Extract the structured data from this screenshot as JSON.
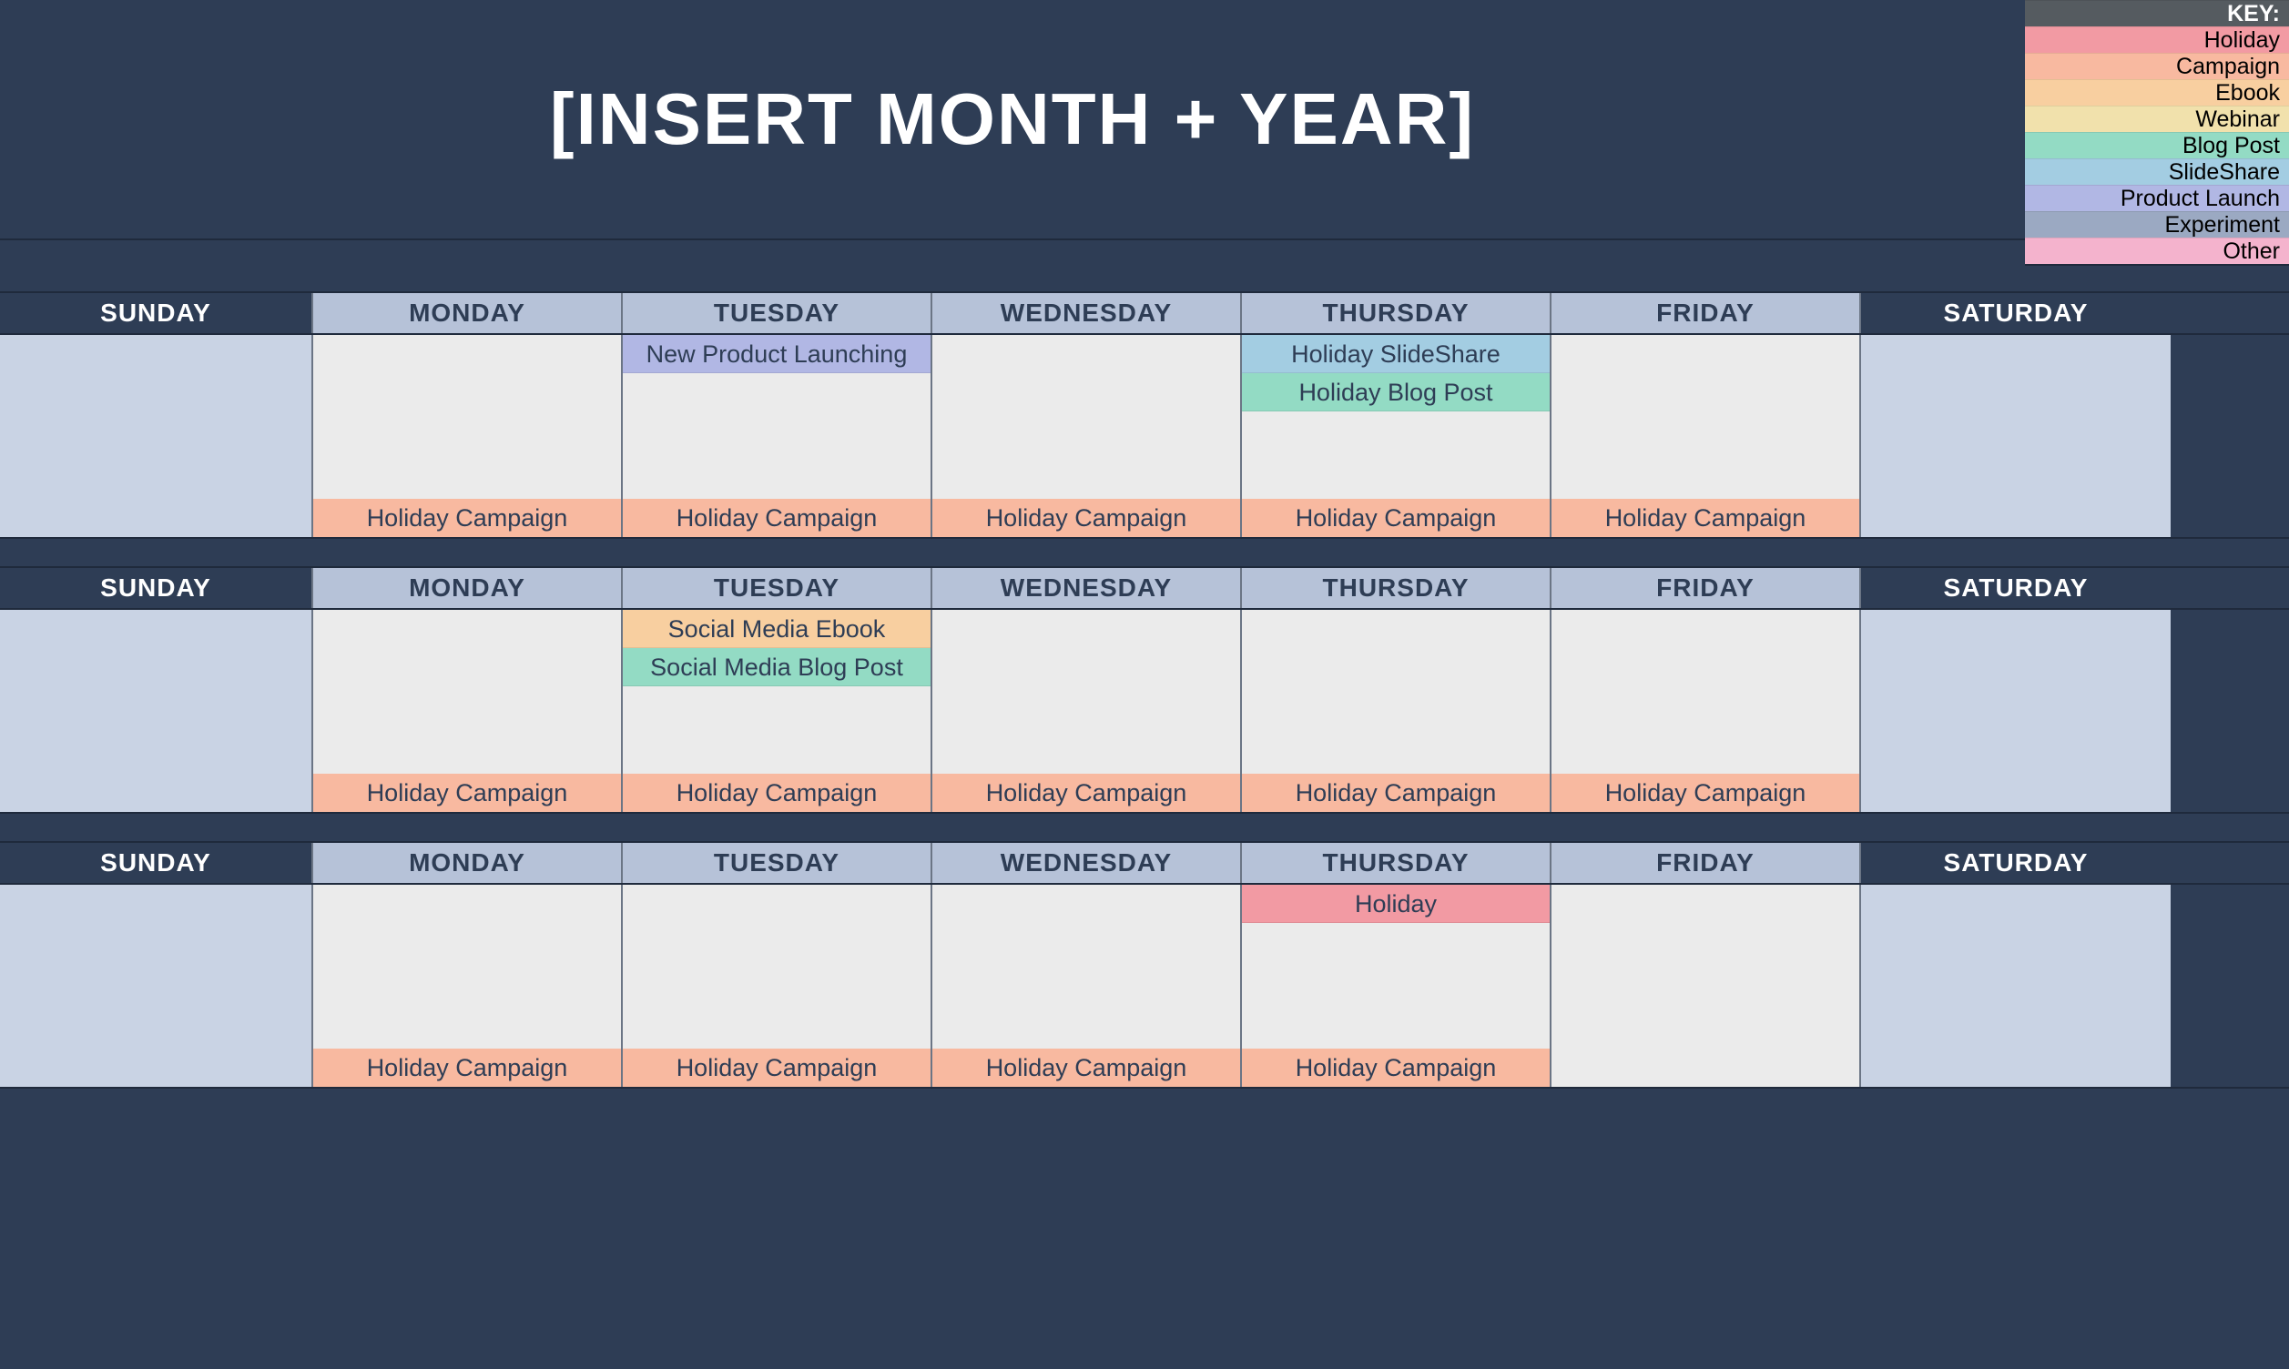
{
  "title": "[INSERT MONTH + YEAR]",
  "key": {
    "header": "KEY:",
    "items": [
      {
        "label": "Holiday",
        "class": "c-holiday"
      },
      {
        "label": "Campaign",
        "class": "c-campaign"
      },
      {
        "label": "Ebook",
        "class": "c-ebook"
      },
      {
        "label": "Webinar",
        "class": "c-webinar"
      },
      {
        "label": "Blog Post",
        "class": "c-blog"
      },
      {
        "label": "SlideShare",
        "class": "c-slide"
      },
      {
        "label": "Product Launch",
        "class": "c-product"
      },
      {
        "label": "Experiment",
        "class": "c-experiment"
      },
      {
        "label": "Other",
        "class": "c-other"
      }
    ]
  },
  "dayNames": [
    "SUNDAY",
    "MONDAY",
    "TUESDAY",
    "WEDNESDAY",
    "THURSDAY",
    "FRIDAY",
    "SATURDAY"
  ],
  "weeks": [
    {
      "days": [
        {
          "weekend": true,
          "top": [],
          "bottom": null
        },
        {
          "weekend": false,
          "top": [],
          "bottom": {
            "label": "Holiday Campaign",
            "class": "c-campaign"
          }
        },
        {
          "weekend": false,
          "top": [
            {
              "label": "New Product Launching",
              "class": "c-product"
            }
          ],
          "bottom": {
            "label": "Holiday Campaign",
            "class": "c-campaign"
          }
        },
        {
          "weekend": false,
          "top": [],
          "bottom": {
            "label": "Holiday Campaign",
            "class": "c-campaign"
          }
        },
        {
          "weekend": false,
          "top": [
            {
              "label": "Holiday SlideShare",
              "class": "c-slide"
            },
            {
              "label": "Holiday Blog Post",
              "class": "c-blog"
            }
          ],
          "bottom": {
            "label": "Holiday Campaign",
            "class": "c-campaign"
          }
        },
        {
          "weekend": false,
          "top": [],
          "bottom": {
            "label": "Holiday Campaign",
            "class": "c-campaign"
          }
        },
        {
          "weekend": true,
          "top": [],
          "bottom": null
        }
      ]
    },
    {
      "days": [
        {
          "weekend": true,
          "top": [],
          "bottom": null
        },
        {
          "weekend": false,
          "top": [],
          "bottom": {
            "label": "Holiday Campaign",
            "class": "c-campaign"
          }
        },
        {
          "weekend": false,
          "top": [
            {
              "label": "Social Media Ebook",
              "class": "c-ebook"
            },
            {
              "label": "Social Media Blog Post",
              "class": "c-blog"
            }
          ],
          "bottom": {
            "label": "Holiday Campaign",
            "class": "c-campaign"
          }
        },
        {
          "weekend": false,
          "top": [],
          "bottom": {
            "label": "Holiday Campaign",
            "class": "c-campaign"
          }
        },
        {
          "weekend": false,
          "top": [],
          "bottom": {
            "label": "Holiday Campaign",
            "class": "c-campaign"
          }
        },
        {
          "weekend": false,
          "top": [],
          "bottom": {
            "label": "Holiday Campaign",
            "class": "c-campaign"
          }
        },
        {
          "weekend": true,
          "top": [],
          "bottom": null
        }
      ]
    },
    {
      "days": [
        {
          "weekend": true,
          "top": [],
          "bottom": null
        },
        {
          "weekend": false,
          "top": [],
          "bottom": {
            "label": "Holiday Campaign",
            "class": "c-campaign"
          }
        },
        {
          "weekend": false,
          "top": [],
          "bottom": {
            "label": "Holiday Campaign",
            "class": "c-campaign"
          }
        },
        {
          "weekend": false,
          "top": [],
          "bottom": {
            "label": "Holiday Campaign",
            "class": "c-campaign"
          }
        },
        {
          "weekend": false,
          "top": [
            {
              "label": "Holiday",
              "class": "c-holiday"
            }
          ],
          "bottom": {
            "label": "Holiday Campaign",
            "class": "c-campaign"
          }
        },
        {
          "weekend": false,
          "top": [],
          "bottom": null
        },
        {
          "weekend": true,
          "top": [],
          "bottom": null
        }
      ]
    }
  ]
}
